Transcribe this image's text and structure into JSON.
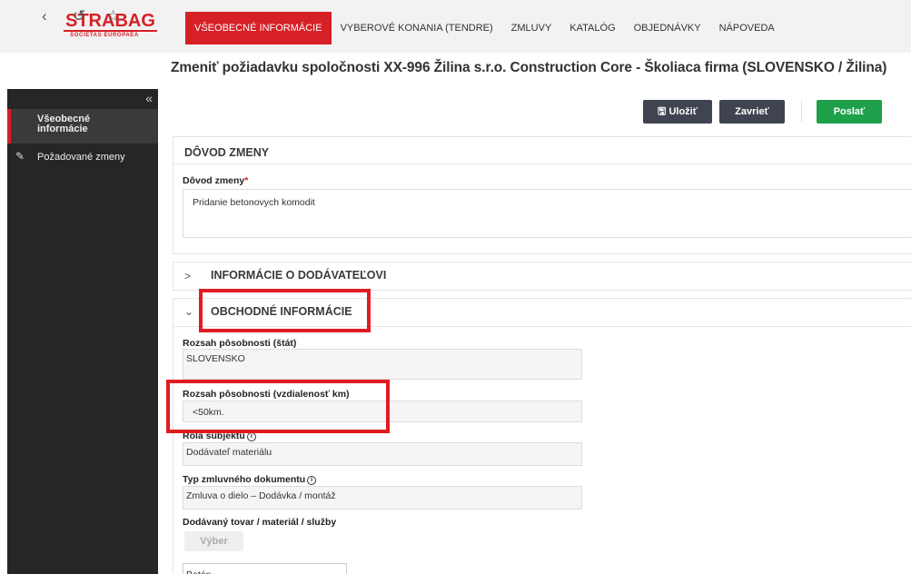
{
  "logo": {
    "line1": "STRABAG",
    "line2": "SOCIETAS EUROPAEA"
  },
  "nav": {
    "items": [
      {
        "label": "VŠEOBECNÉ INFORMÁCIE",
        "active": true
      },
      {
        "label": "VYBEROVÉ KONANIA (TENDRE)"
      },
      {
        "label": "ZMLUVY"
      },
      {
        "label": "KATALÓG"
      },
      {
        "label": "OBJEDNÁVKY"
      },
      {
        "label": "NÁPOVEDA"
      }
    ]
  },
  "toolbar_icons": {
    "back": "‹",
    "history": "↺",
    "favorite": "☆"
  },
  "page_title": "Zmeniť požiadavku spoločnosti XX-996 Žilina s.r.o. Construction Core - Školiaca firma (SLOVENSKO / Žilina)",
  "sidebar": {
    "collapse": "«",
    "items": [
      {
        "label": "Všeobecné informácie",
        "active": true
      },
      {
        "label": "Požadované zmeny",
        "icon": "edit-icon"
      }
    ]
  },
  "actions": {
    "save": "Uložiť",
    "close": "Zavrieť",
    "send": "Poslať"
  },
  "sections": {
    "change_reason": {
      "title": "DÔVOD ZMENY",
      "field_label": "Dôvod zmeny",
      "required_mark": "*",
      "value": "Pridanie betonovych komodit"
    },
    "supplier_info": {
      "title": "INFORMÁCIE O DODÁVATEĽOVI",
      "expanded": false
    },
    "business_info": {
      "title": "OBCHODNÉ INFORMÁCIE",
      "expanded": true,
      "fields": [
        {
          "label": "Rozsah pôsobnosti (štát)",
          "value": "SLOVENSKO"
        },
        {
          "label": "Rozsah pôsobnosti (vzdialenosť km)",
          "value": "<50km."
        },
        {
          "label": "Rola subjektu",
          "value": "Dodávateľ materiálu"
        },
        {
          "label": "Typ zmluvného dokumentu",
          "value": "Zmluva o dielo – Dodávka / montáž"
        }
      ],
      "goods_label": "Dodávaný tovar / materiál / služby",
      "select_button": "Výber",
      "selected_item": "Betón"
    }
  },
  "colors": {
    "brand_red": "#d71f26",
    "dark_button": "#3f4450",
    "green_button": "#1ea04a",
    "sidebar_bg": "#262626"
  }
}
